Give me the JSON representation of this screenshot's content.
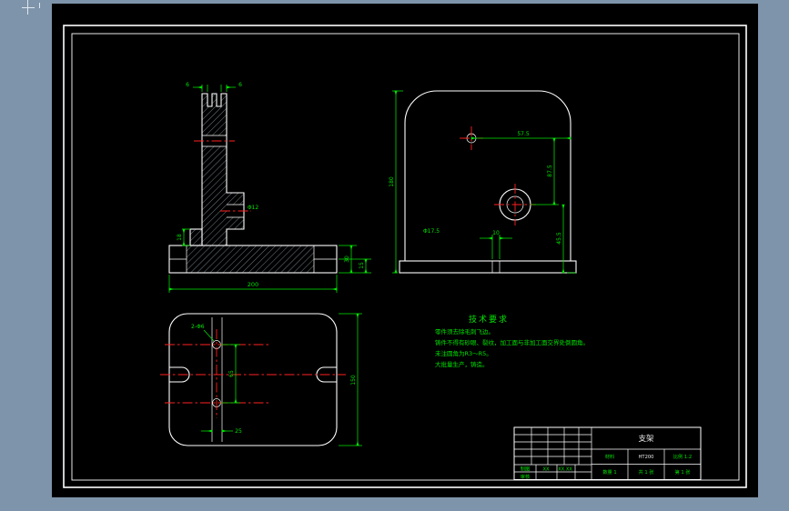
{
  "colors": {
    "background": "#7e94aa",
    "canvas": "#000000",
    "outline": "#ffffff",
    "dimension": "#00e400",
    "centerline": "#ff2020"
  },
  "front_view": {
    "dims": {
      "slot_left": "6",
      "slot_right": "6",
      "bore": "Φ12",
      "step": "18",
      "width": "200",
      "base_h": "30",
      "flange_h": "15"
    }
  },
  "side_view": {
    "dims": {
      "height": "180",
      "offset_top": "57.5",
      "centers": "87.5",
      "offset_bottom": "45.5",
      "slot": "10",
      "bore": "Φ17.5"
    }
  },
  "top_view": {
    "dims": {
      "depth": "150",
      "centers": "65",
      "wall": "25",
      "holes": "2-Φ6"
    }
  },
  "tech": {
    "title": "技术要求",
    "lines": [
      "零件须去除毛刺飞边。",
      "铸件不得有砂眼、裂纹，加工面与非加工面交界处倒圆角。",
      "未注圆角为R3～R5。",
      "大批量生产，铸造。"
    ]
  },
  "title_block": {
    "drawn": "制图",
    "checked": "审核",
    "name": "XX",
    "date": "XX.XX",
    "part": "支架",
    "material_label": "材料",
    "material": "HT200",
    "scale": "比例 1:2",
    "qty": "数量 1",
    "sheets": "共 1 张",
    "sheet": "第 1 张"
  }
}
